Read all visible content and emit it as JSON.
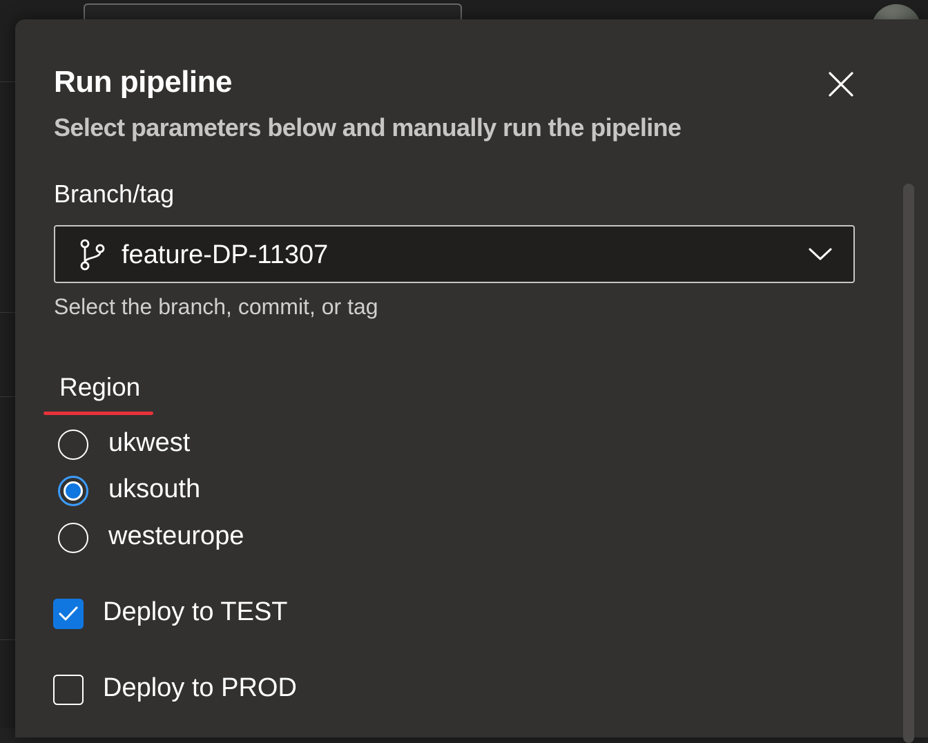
{
  "dialog": {
    "title": "Run pipeline",
    "subtitle": "Select parameters below and manually run the pipeline"
  },
  "branch": {
    "label": "Branch/tag",
    "value": "feature-DP-11307",
    "hint": "Select the branch, commit, or tag",
    "icon": "git-branch-icon"
  },
  "region": {
    "label": "Region",
    "options": [
      {
        "label": "ukwest",
        "checked": false
      },
      {
        "label": "uksouth",
        "checked": true
      },
      {
        "label": "westeurope",
        "checked": false
      }
    ]
  },
  "checkboxes": [
    {
      "label": "Deploy to TEST",
      "checked": true
    },
    {
      "label": "Deploy to PROD",
      "checked": false
    }
  ],
  "colors": {
    "panel": "#323130",
    "accent": "#1177e0",
    "annotation": "#e8323a"
  }
}
